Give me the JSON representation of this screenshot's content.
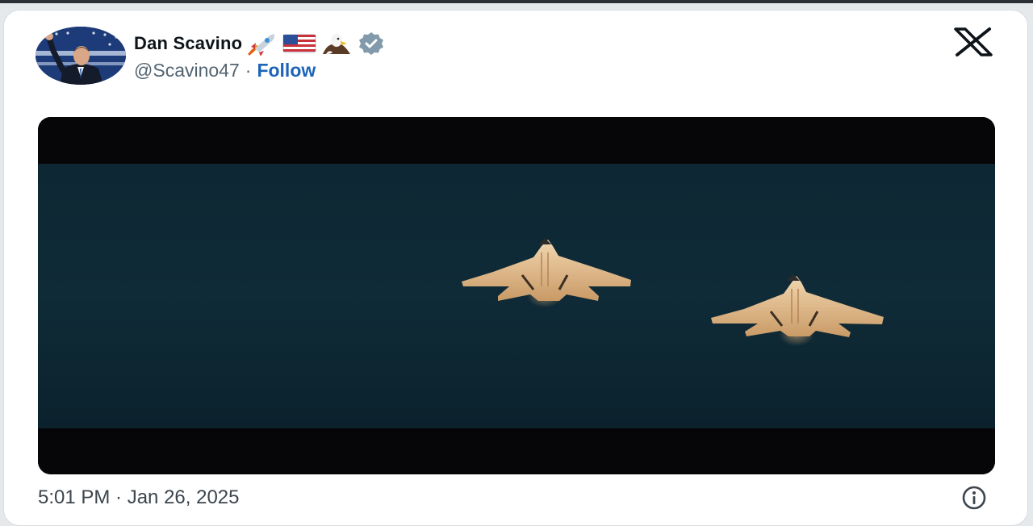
{
  "tweet": {
    "author": {
      "display_name": "Dan Scavino",
      "name_emojis": [
        "rocket-emoji",
        "us-flag-emoji",
        "eagle-emoji"
      ],
      "verified": true,
      "handle": "@Scavino47"
    },
    "separator": "·",
    "follow_label": "Follow",
    "timestamp": "5:01 PM · Jan 26, 2025"
  },
  "icons": {
    "platform": "x-logo-icon",
    "verified": "verified-badge-icon",
    "info": "info-icon"
  },
  "colors": {
    "follow": "#1d64b8",
    "verified_badge": "#829aab",
    "video_water": "#0f2a36"
  }
}
